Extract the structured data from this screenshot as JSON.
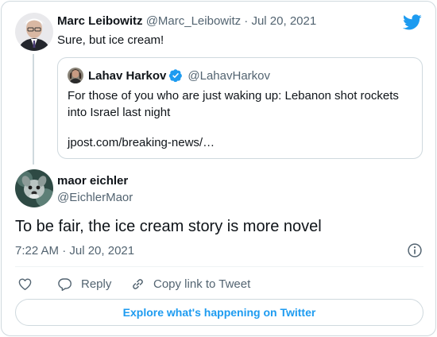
{
  "parent_tweet": {
    "author_name": "Marc Leibowitz",
    "meta": "@Marc_Leibowitz · Jul 20, 2021",
    "text": "Sure, but ice cream!",
    "avatar_icon": "person-avatar"
  },
  "quoted_tweet": {
    "author_name": "Lahav Harkov",
    "handle": "@LahavHarkov",
    "verified": true,
    "text": "For those of you who are just waking up: Lebanon shot rockets into Israel last night",
    "link": "jpost.com/breaking-news/…",
    "avatar_icon": "person-avatar"
  },
  "reply_tweet": {
    "author_name": "maor eichler",
    "handle": "@EichlerMaor",
    "text": "To be fair, the ice cream story is more novel",
    "timestamp": "7:22 AM · Jul 20, 2021",
    "avatar_icon": "dog-avatar"
  },
  "actions": {
    "like_icon": "heart-icon",
    "reply_label": "Reply",
    "reply_icon": "speech-bubble-icon",
    "copy_label": "Copy link to Tweet",
    "copy_icon": "link-icon"
  },
  "explore_label": "Explore what's happening on Twitter",
  "colors": {
    "brand": "#1d9bf0",
    "text": "#0f1419",
    "secondary": "#536471",
    "border": "#cfd9de"
  },
  "icons": {
    "brand": "twitter-bird-icon",
    "info": "info-icon",
    "verified": "verified-badge-icon"
  }
}
